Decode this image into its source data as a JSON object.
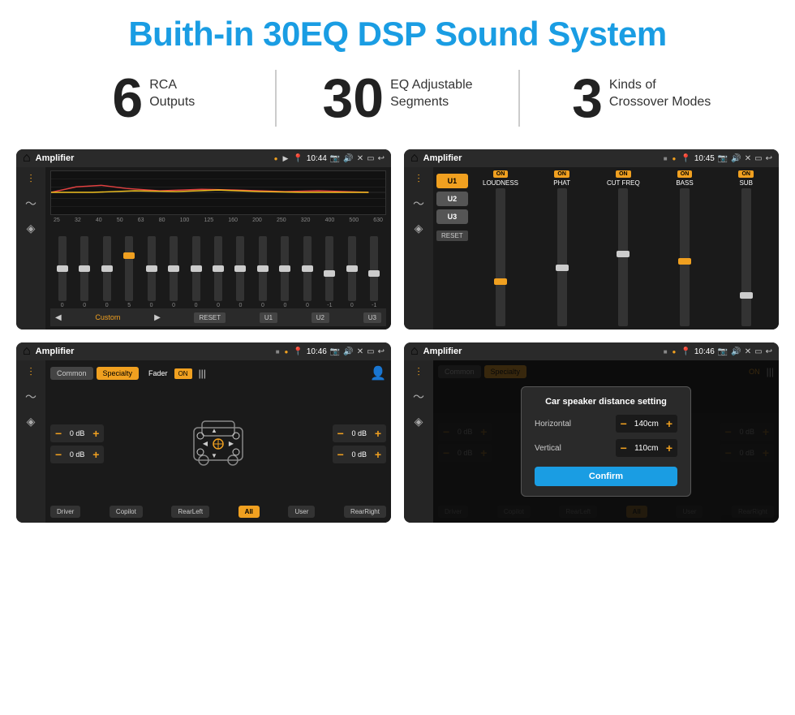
{
  "header": {
    "title": "Buith-in 30EQ DSP Sound System"
  },
  "stats": [
    {
      "number": "6",
      "label": "RCA\nOutputs"
    },
    {
      "number": "30",
      "label": "EQ Adjustable\nSegments"
    },
    {
      "number": "3",
      "label": "Kinds of\nCrossover Modes"
    }
  ],
  "screens": {
    "eq_screen": {
      "title": "Amplifier",
      "time": "10:44",
      "eq_freqs": [
        "25",
        "32",
        "40",
        "50",
        "63",
        "80",
        "100",
        "125",
        "160",
        "200",
        "250",
        "320",
        "400",
        "500",
        "630"
      ],
      "eq_values": [
        "0",
        "0",
        "0",
        "5",
        "0",
        "0",
        "0",
        "0",
        "0",
        "0",
        "0",
        "0",
        "-1",
        "0",
        "-1"
      ],
      "preset_label": "Custom",
      "buttons": [
        "RESET",
        "U1",
        "U2",
        "U3"
      ]
    },
    "crossover_screen": {
      "title": "Amplifier",
      "time": "10:45",
      "presets": [
        "U1",
        "U2",
        "U3"
      ],
      "channels": [
        {
          "label": "LOUDNESS",
          "on": true
        },
        {
          "label": "PHAT",
          "on": true
        },
        {
          "label": "CUT FREQ",
          "on": true
        },
        {
          "label": "BASS",
          "on": true
        },
        {
          "label": "SUB",
          "on": true
        }
      ],
      "reset_label": "RESET"
    },
    "fader_screen": {
      "title": "Amplifier",
      "time": "10:46",
      "tabs": [
        "Common",
        "Specialty"
      ],
      "active_tab": "Specialty",
      "fader_label": "Fader",
      "on_label": "ON",
      "db_values": [
        "0 dB",
        "0 dB",
        "0 dB",
        "0 dB"
      ],
      "footer_btns": [
        "Driver",
        "Copilot",
        "RearLeft",
        "All",
        "User",
        "RearRight"
      ]
    },
    "dialog_screen": {
      "title": "Amplifier",
      "time": "10:46",
      "tabs": [
        "Common",
        "Specialty"
      ],
      "on_label": "ON",
      "dialog": {
        "title": "Car speaker distance setting",
        "rows": [
          {
            "label": "Horizontal",
            "value": "140cm"
          },
          {
            "label": "Vertical",
            "value": "110cm"
          }
        ],
        "confirm_label": "Confirm"
      },
      "db_values": [
        "0 dB",
        "0 dB"
      ],
      "footer_btns": [
        "Driver",
        "Copilot",
        "RearLeft",
        "All",
        "User",
        "RearRight"
      ]
    }
  },
  "icons": {
    "home": "⌂",
    "play": "▶",
    "back": "↩",
    "location": "📍",
    "speaker": "🔊",
    "eq_icon": "⫶",
    "wave_icon": "〜",
    "volume_icon": "◈"
  }
}
